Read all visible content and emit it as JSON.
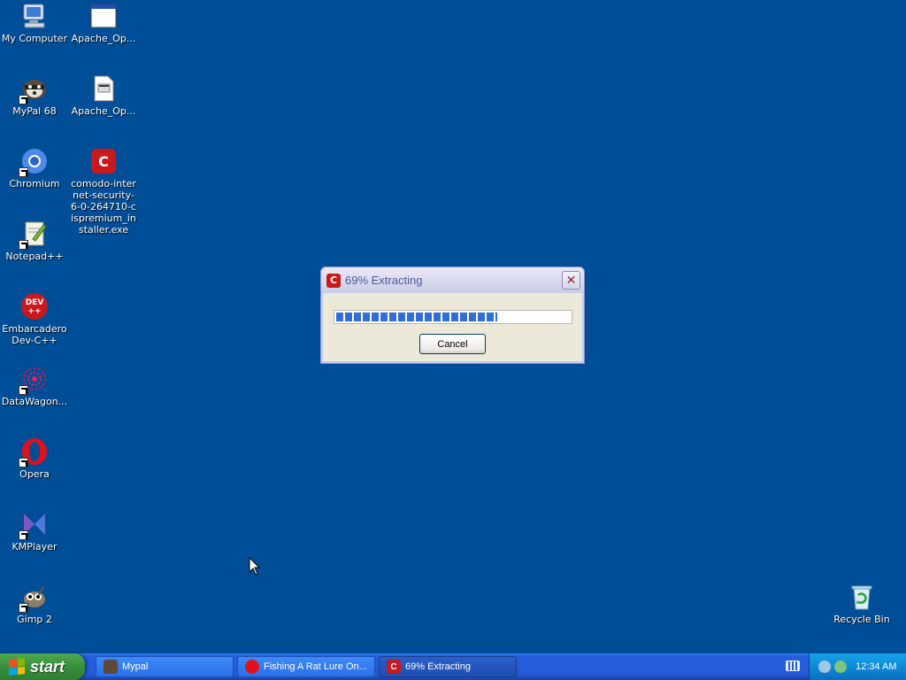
{
  "desktop": {
    "icons": [
      {
        "label": "My Computer",
        "icon": "my-computer-icon"
      },
      {
        "label": "Apache_Op...",
        "icon": "application-window-icon"
      },
      {
        "label": "MyPal 68",
        "icon": "mypal-icon"
      },
      {
        "label": "Apache_Op...",
        "icon": "document-icon"
      },
      {
        "label": "Chromium",
        "icon": "chromium-icon"
      },
      {
        "label": "comodo-internet-security-6-0-264710-cispremium_installer.exe",
        "icon": "comodo-icon"
      },
      {
        "label": "Notepad++",
        "icon": "notepadpp-icon"
      },
      {
        "label": "Embarcadero Dev-C++",
        "icon": "devcpp-icon"
      },
      {
        "label": "DataWagon...",
        "icon": "datawagon-icon"
      },
      {
        "label": "Opera",
        "icon": "opera-icon"
      },
      {
        "label": "KMPlayer",
        "icon": "kmplayer-icon"
      },
      {
        "label": "Gimp 2",
        "icon": "gimp-icon"
      },
      {
        "label": "Recycle Bin",
        "icon": "recycle-bin-icon"
      }
    ]
  },
  "dialog": {
    "title": "69% Extracting",
    "icon_letter": "C",
    "progress_percent": 69,
    "cancel_label": "Cancel",
    "close_glyph": "✕"
  },
  "taskbar": {
    "start_label": "start",
    "tasks": [
      {
        "label": "Mypal",
        "icon": "mypal-icon"
      },
      {
        "label": "Fishing A Rat Lure On...",
        "icon": "opera-icon"
      },
      {
        "label": "69% Extracting",
        "icon": "comodo-icon"
      }
    ],
    "clock": "12:34 AM"
  },
  "colors": {
    "desktop_bg": "#004e98",
    "comodo_red": "#c8191d",
    "progress_blue": "#2f6ed7"
  }
}
